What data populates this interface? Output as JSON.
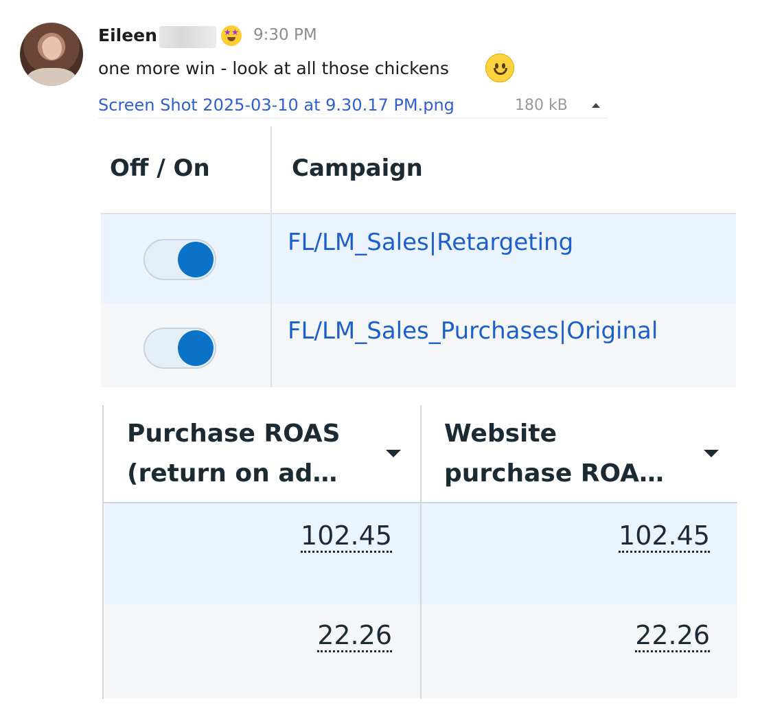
{
  "message": {
    "sender": "Eileen",
    "time": "9:30 PM",
    "text": "one more win - look at all those chickens",
    "status_emoji": "star-struck-emoji",
    "inline_emoji": "slightly-smiling-face-emoji",
    "attachment": {
      "file_name": "Screen Shot 2025-03-10 at 9.30.17 PM.png",
      "file_size": "180 kB"
    }
  },
  "campaign_table": {
    "headers": [
      "Off / On",
      "Campaign"
    ],
    "rows": [
      {
        "toggle_on": true,
        "campaign": "FL/LM_Sales|Retargeting"
      },
      {
        "toggle_on": true,
        "campaign": "FL/LM_Sales_Purchases|Original"
      }
    ]
  },
  "metrics_table": {
    "headers": [
      "Purchase ROAS\n(return on ad…",
      "Website\npurchase ROA…"
    ],
    "rows": [
      [
        "102.45",
        "102.45"
      ],
      [
        "22.26",
        "22.26"
      ]
    ]
  },
  "colors": {
    "link": "#1a5fcc",
    "toggle_on": "#0a73c7",
    "selected_row": "#ebf3ff",
    "alt_row": "#f5f6f7"
  }
}
